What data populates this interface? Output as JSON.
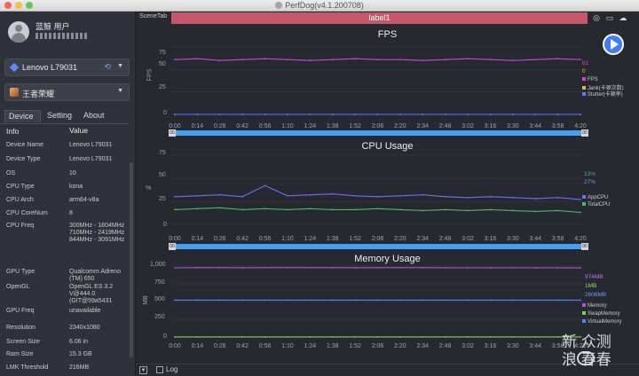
{
  "window": {
    "title": "PerfDog(v4.1.200708)"
  },
  "sidebar": {
    "user_name": "蓝鲸 用户",
    "device": {
      "name": "Lenovo L79031",
      "icon": "diamond-icon",
      "link_icon": "link-icon"
    },
    "app": {
      "name": "王者荣耀",
      "icon": "app-icon"
    },
    "tabs": [
      {
        "label": "Device",
        "active": true
      },
      {
        "label": "Setting",
        "active": false
      },
      {
        "label": "About",
        "active": false
      }
    ],
    "table": {
      "headers": [
        "Info",
        "Value"
      ],
      "rows": [
        {
          "key": "Device Name",
          "value": "Lenovo L79031"
        },
        {
          "key": "Device Type",
          "value": "Lenovo L79031"
        },
        {
          "key": "OS",
          "value": "10"
        },
        {
          "key": "CPU Type",
          "value": "kona"
        },
        {
          "key": "CPU Arch",
          "value": "arm64-v8a"
        },
        {
          "key": "CPU CoreNum",
          "value": "8"
        },
        {
          "key": "CPU Freq",
          "value": "300MHz - 1804MHz 710MHz - 2419MHz 844MHz - 3091MHz"
        },
        {
          "key": "GPU Type",
          "value": "Qualcomm Adreno (TM) 650"
        },
        {
          "key": "OpenGL",
          "value": "OpenGL ES 3.2 V@444.0 (GIT@59a5431"
        },
        {
          "key": "GPU Freq",
          "value": "unavailable"
        },
        {
          "key": "Resolution",
          "value": "2340x1080"
        },
        {
          "key": "Screen Size",
          "value": "6.06 in"
        },
        {
          "key": "Ram Size",
          "value": "15.3 GB"
        },
        {
          "key": "LMK Threshold",
          "value": "216MB"
        }
      ]
    }
  },
  "toolbar": {
    "scene_label": "SceneTab",
    "scene_name": "label1",
    "icons": [
      "target-icon",
      "folder-icon",
      "cloud-icon"
    ]
  },
  "x_ticks": [
    "0:00",
    "0:14",
    "0:28",
    "0:42",
    "0:56",
    "1:10",
    "1:24",
    "1:38",
    "1:52",
    "2:06",
    "2:20",
    "2:34",
    "2:48",
    "3:02",
    "3:16",
    "3:30",
    "3:44",
    "3:58",
    "4:20"
  ],
  "scroller": {
    "start_cap": "00",
    "end_cap": "00"
  },
  "footer": {
    "log_label": "Log",
    "log_checked": false
  },
  "watermark": {
    "line1": "新 众测",
    "line2": "浪 春春"
  },
  "colors": {
    "fps": "#d63fd6",
    "jank": "#f2b030",
    "stutter": "#5079ff",
    "app_cpu": "#6c6ff2",
    "total_cpu": "#3fbf6a",
    "memory": "#b84fd9",
    "swap": "#7bd44c",
    "virtual": "#4a82ff",
    "accent": "#3f7cff",
    "scene_bar": "#c5576a"
  },
  "chart_data": [
    {
      "type": "line",
      "title": "FPS",
      "ylabel": "FPS",
      "ylim": [
        0,
        75
      ],
      "yticks": [
        0,
        25,
        50,
        75
      ],
      "x": [
        "0:00",
        "0:14",
        "0:28",
        "0:42",
        "0:56",
        "1:10",
        "1:24",
        "1:38",
        "1:52",
        "2:06",
        "2:20",
        "2:34",
        "2:48",
        "3:02",
        "3:16",
        "3:30",
        "3:44",
        "3:58",
        "4:20"
      ],
      "series": [
        {
          "name": "FPS",
          "values": [
            61,
            62,
            60,
            61,
            62,
            61,
            60,
            61,
            62,
            61,
            61,
            60,
            61,
            62,
            61,
            60,
            61,
            62,
            61
          ]
        },
        {
          "name": "Jank(卡顿次数)",
          "values": [
            0,
            0,
            0,
            0,
            0,
            0,
            0,
            0,
            0,
            0,
            0,
            0,
            0,
            0,
            0,
            0,
            0,
            0,
            0
          ]
        },
        {
          "name": "Stutter(卡顿率)",
          "values": [
            0,
            0,
            0,
            0,
            0,
            0,
            0,
            0,
            0,
            0,
            0,
            0,
            0,
            0,
            0,
            0,
            0,
            0,
            0
          ]
        }
      ],
      "current_values": [
        "61",
        "0"
      ]
    },
    {
      "type": "line",
      "title": "CPU Usage",
      "ylabel": "%",
      "ylim": [
        0,
        75
      ],
      "yticks": [
        0,
        25,
        50,
        75
      ],
      "x": [
        "0:00",
        "0:14",
        "0:28",
        "0:42",
        "0:56",
        "1:10",
        "1:24",
        "1:38",
        "1:52",
        "2:06",
        "2:20",
        "2:34",
        "2:48",
        "3:02",
        "3:16",
        "3:30",
        "3:44",
        "3:58",
        "4:20"
      ],
      "series": [
        {
          "name": "AppCPU",
          "values": [
            30,
            31,
            32,
            30,
            42,
            31,
            32,
            33,
            31,
            30,
            31,
            32,
            30,
            29,
            30,
            29,
            28,
            29,
            27
          ]
        },
        {
          "name": "TotalCPU",
          "values": [
            16,
            17,
            18,
            16,
            17,
            16,
            17,
            16,
            16,
            17,
            16,
            15,
            16,
            15,
            16,
            15,
            14,
            15,
            13
          ]
        }
      ],
      "current_values": [
        "13%",
        "27%"
      ]
    },
    {
      "type": "line",
      "title": "Memory Usage",
      "ylabel": "MB",
      "ylim": [
        0,
        1000
      ],
      "yticks": [
        0,
        250,
        500,
        750,
        "1,000"
      ],
      "x": [
        "0:00",
        "0:14",
        "0:28",
        "0:42",
        "0:56",
        "1:10",
        "1:24",
        "1:38",
        "1:52",
        "2:06",
        "2:20",
        "2:34",
        "2:48",
        "3:02",
        "3:16",
        "3:30",
        "3:44",
        "3:58",
        "4:20"
      ],
      "series": [
        {
          "name": "Memory",
          "values": [
            975,
            978,
            977,
            976,
            978,
            979,
            978,
            977,
            976,
            977,
            978,
            977,
            976,
            975,
            976,
            975,
            976,
            975,
            974
          ]
        },
        {
          "name": "SwapMemory",
          "values": [
            1,
            1,
            1,
            1,
            1,
            1,
            1,
            1,
            1,
            1,
            1,
            1,
            1,
            1,
            1,
            1,
            1,
            1,
            1
          ]
        },
        {
          "name": "VirtualMemory",
          "values": [
            520,
            520,
            520,
            520,
            520,
            520,
            520,
            520,
            520,
            520,
            520,
            520,
            520,
            520,
            520,
            520,
            520,
            520,
            520
          ]
        }
      ],
      "current_values": [
        "974MB",
        "1MB",
        "2606MB"
      ]
    }
  ]
}
